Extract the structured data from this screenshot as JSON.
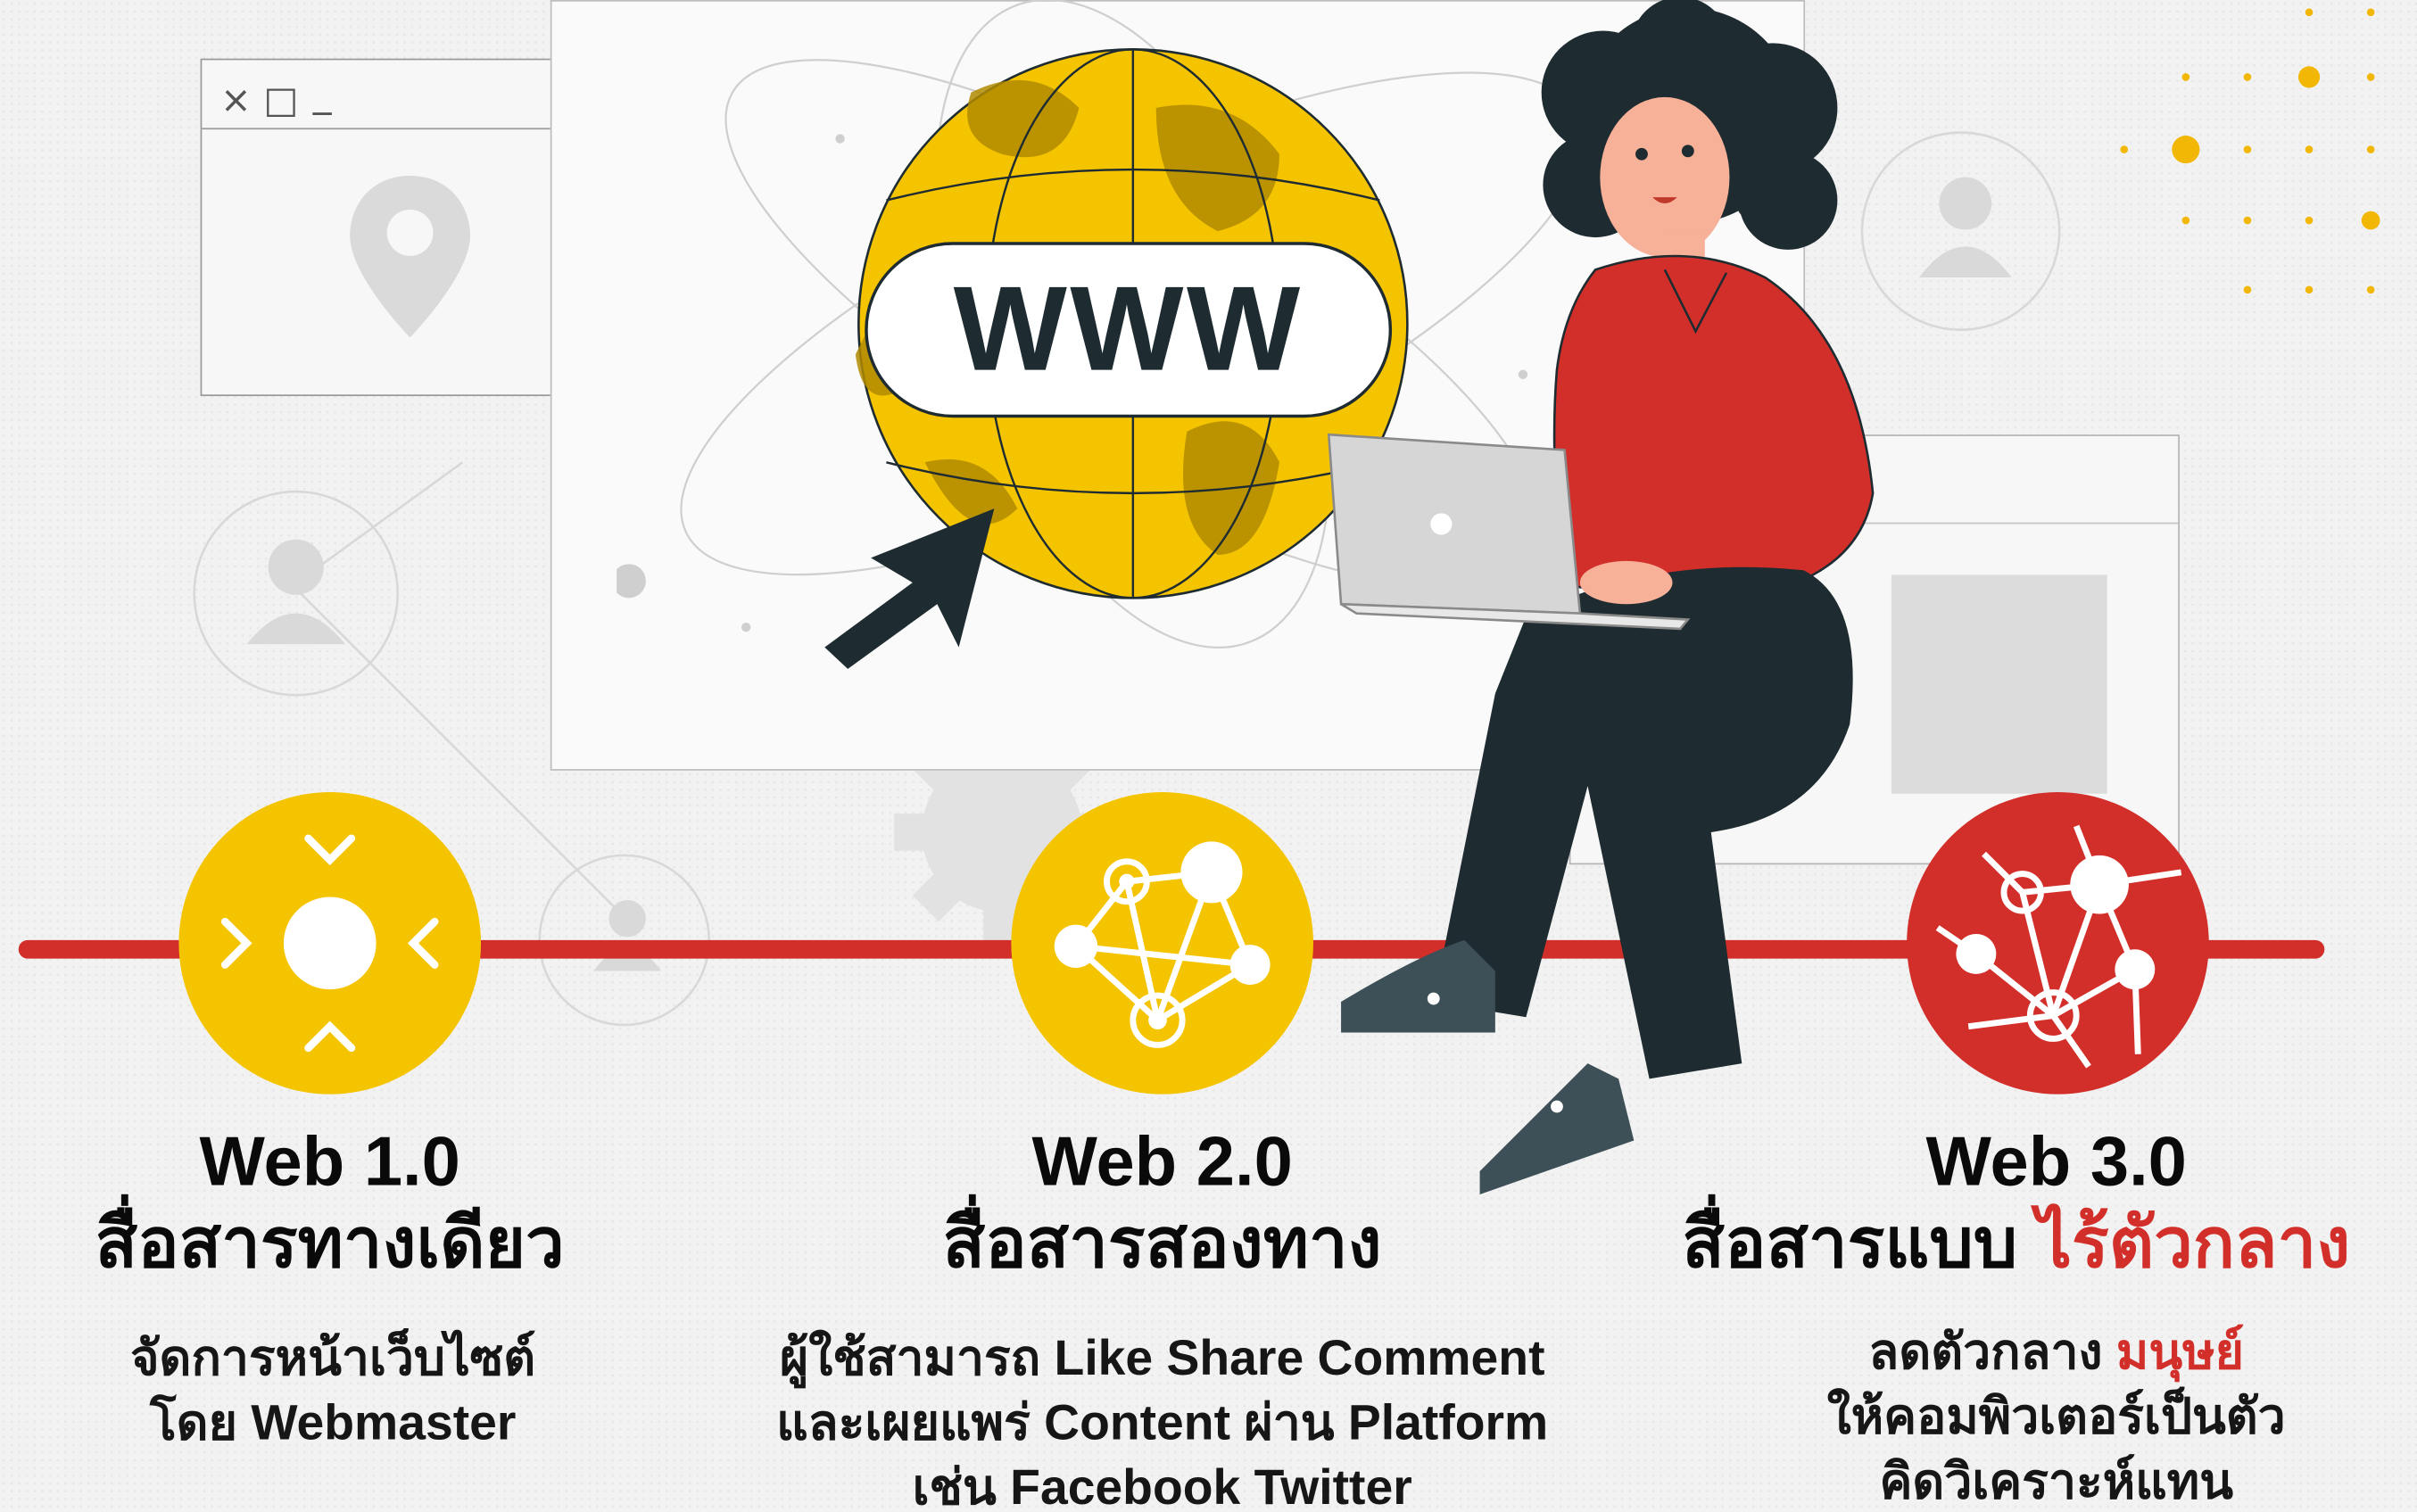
{
  "window_controls": {
    "close": "×",
    "maximize": "□",
    "minimize": "_"
  },
  "globe": {
    "label": "WWW"
  },
  "colors": {
    "yellow": "#f5c400",
    "red": "#d32f2a",
    "dark": "#1e2b30"
  },
  "stages": [
    {
      "icon": "target-icon",
      "web_label": "Web 1.0",
      "thai_title": "สื่อสารทางเดียว",
      "desc_lines": [
        "จัดการหน้าเว็บไซต์",
        "โดย Webmaster"
      ]
    },
    {
      "icon": "network-icon",
      "web_label": "Web 2.0",
      "thai_title": "สื่อสารสองทาง",
      "desc_lines": [
        "ผู้ใช้สามารถ Like Share Comment",
        "และเผยแพร่ Content ผ่าน Platform",
        "เช่น Facebook Twitter"
      ]
    },
    {
      "icon": "decentralized-network-icon",
      "web_label": "Web 3.0",
      "thai_title_prefix": "สื่อสารแบบ ",
      "thai_title_highlight": "ไร้ตัวกลาง",
      "desc_line1_prefix": "ลดตัวกลาง ",
      "desc_line1_highlight": "มนุษย์",
      "desc_lines": [
        "ให้คอมพิวเตอร์เป็นตัว",
        "คิดวิเคราะห์แทน"
      ]
    }
  ]
}
